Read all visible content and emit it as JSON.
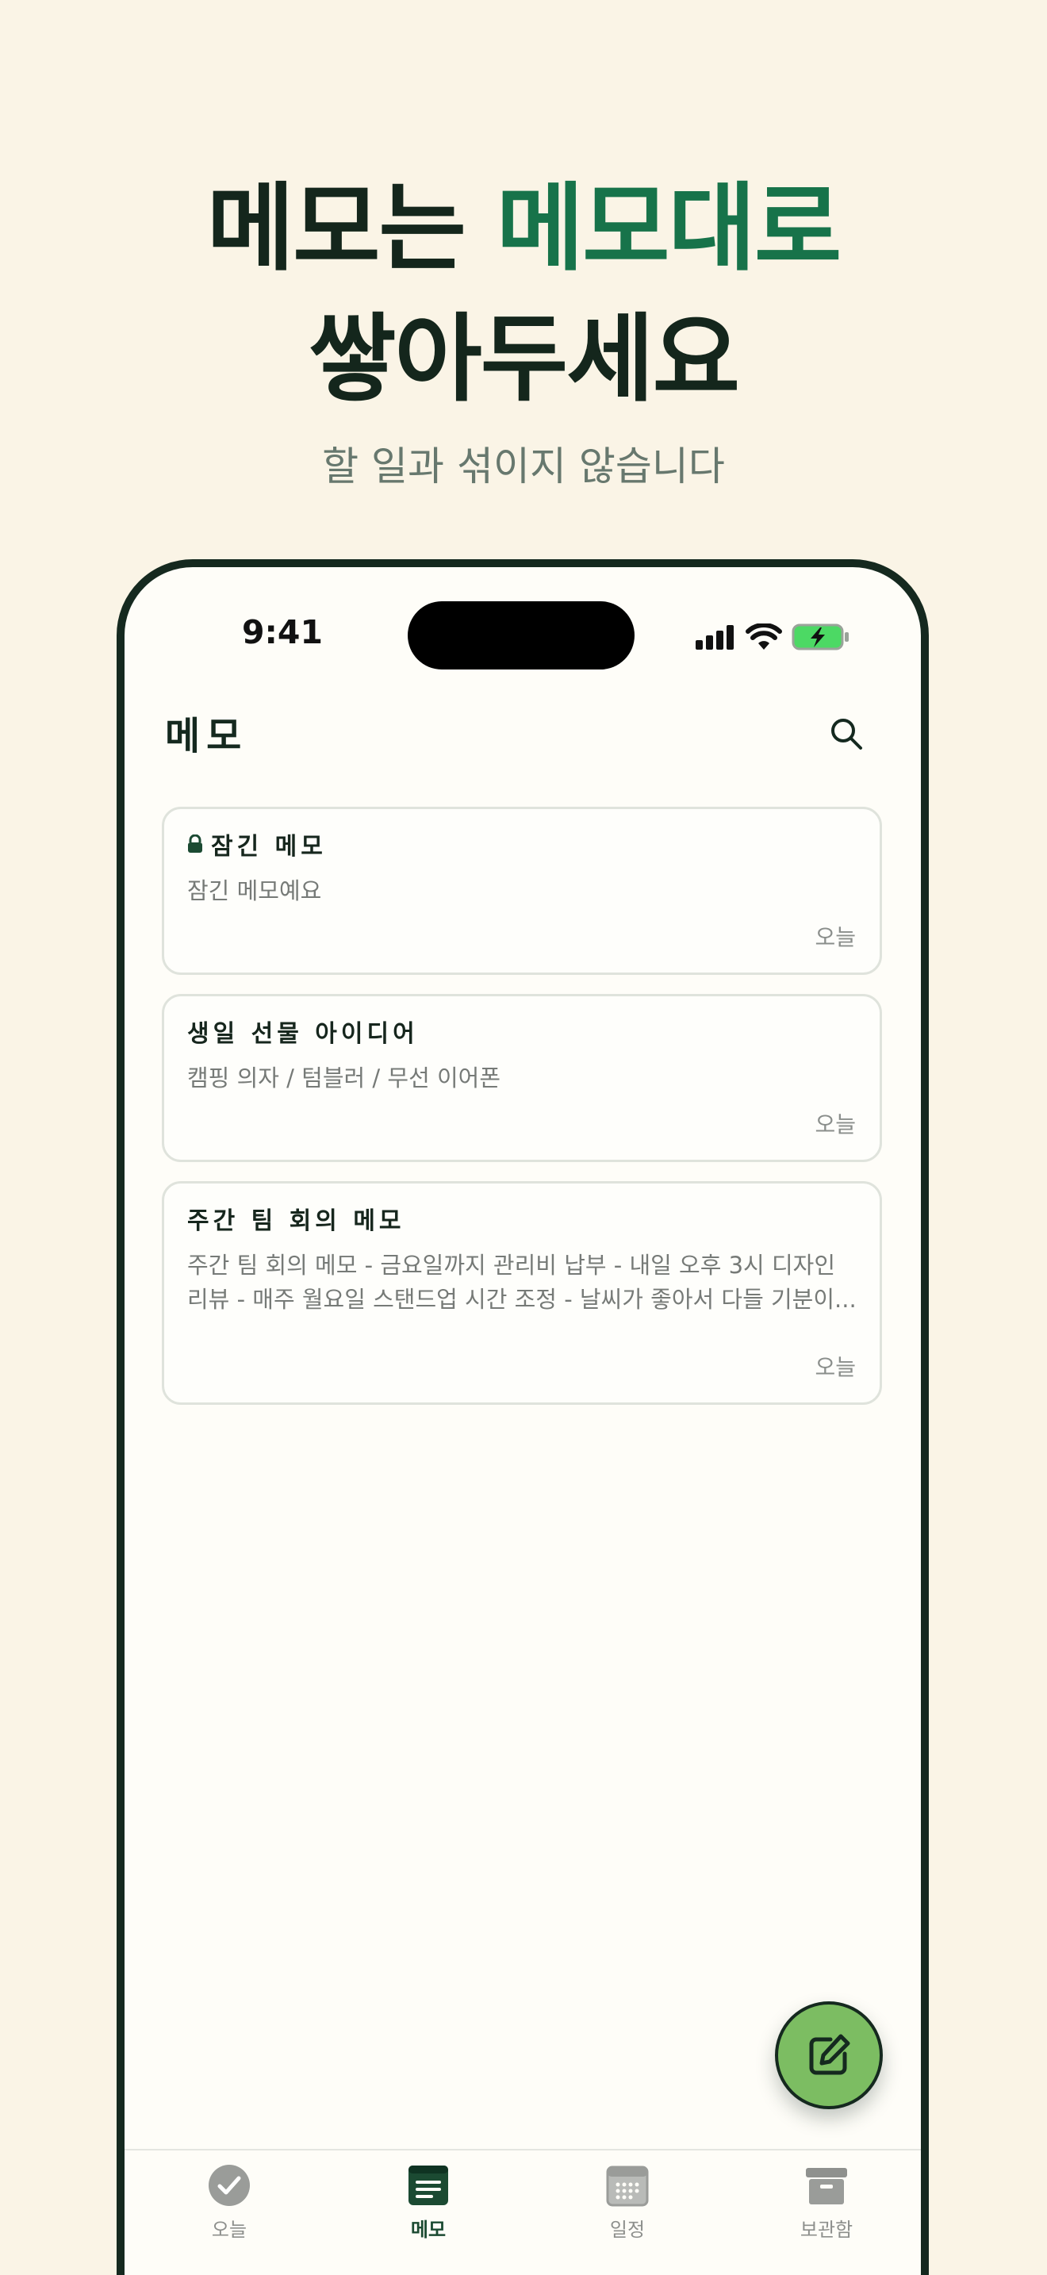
{
  "headline": {
    "line1_prefix": "메모는",
    "line1_accent": "메모대로",
    "line2": "쌓아두세요"
  },
  "subtitle": "할 일과 섞이지 않습니다",
  "status_bar": {
    "time": "9:41"
  },
  "screen": {
    "title": "메모",
    "search_icon": "search-icon"
  },
  "memos": [
    {
      "title": "잠긴 메모",
      "locked": true,
      "body": "잠긴 메모예요",
      "date": "오늘"
    },
    {
      "title": "생일 선물 아이디어",
      "locked": false,
      "body": "캠핑 의자 / 텀블러 / 무선 이어폰",
      "date": "오늘"
    },
    {
      "title": "주간 팀 회의 메모",
      "locked": false,
      "body": "주간 팀 회의 메모  - 금요일까지 관리비 납부 - 내일 오후 3시 디자인 리뷰 - 매주 월요일 스탠드업 시간 조정 - 날씨가 좋아서 다들 기분이...",
      "date": "오늘"
    }
  ],
  "fab": {
    "icon": "compose-icon"
  },
  "tabs": [
    {
      "label": "오늘",
      "icon": "check-circle-icon",
      "active": false
    },
    {
      "label": "메모",
      "icon": "memo-icon",
      "active": true
    },
    {
      "label": "일정",
      "icon": "calendar-icon",
      "active": false
    },
    {
      "label": "보관함",
      "icon": "archive-icon",
      "active": false
    }
  ],
  "colors": {
    "background": "#faf4e6",
    "accent": "#17734a",
    "dark": "#15291f",
    "fab": "#7cbd62",
    "battery": "#4cd964"
  }
}
